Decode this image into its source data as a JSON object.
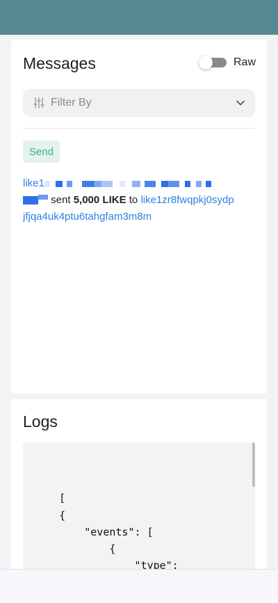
{
  "messages": {
    "title": "Messages",
    "raw_label": "Raw",
    "filter_placeholder": "Filter By",
    "send_badge": "Send",
    "message": {
      "sender_prefix": "like1",
      "verb": "sent",
      "amount": "5,000 LIKE",
      "preposition": "to",
      "recipient_line1": "like1zr8fwqpkj0sydp",
      "recipient_line2": "jfjqa4uk4ptu6tahgfam3m8m"
    }
  },
  "logs": {
    "title": "Logs",
    "code": "[\n    {\n        \"events\": [\n            {\n                \"type\":\n\"coin_received\",\n                \"attributes\":"
  },
  "colors": {
    "header": "#588893",
    "link": "#2f7fe0",
    "send_badge_bg": "#e3f2ec",
    "send_badge_text": "#3fae87"
  }
}
